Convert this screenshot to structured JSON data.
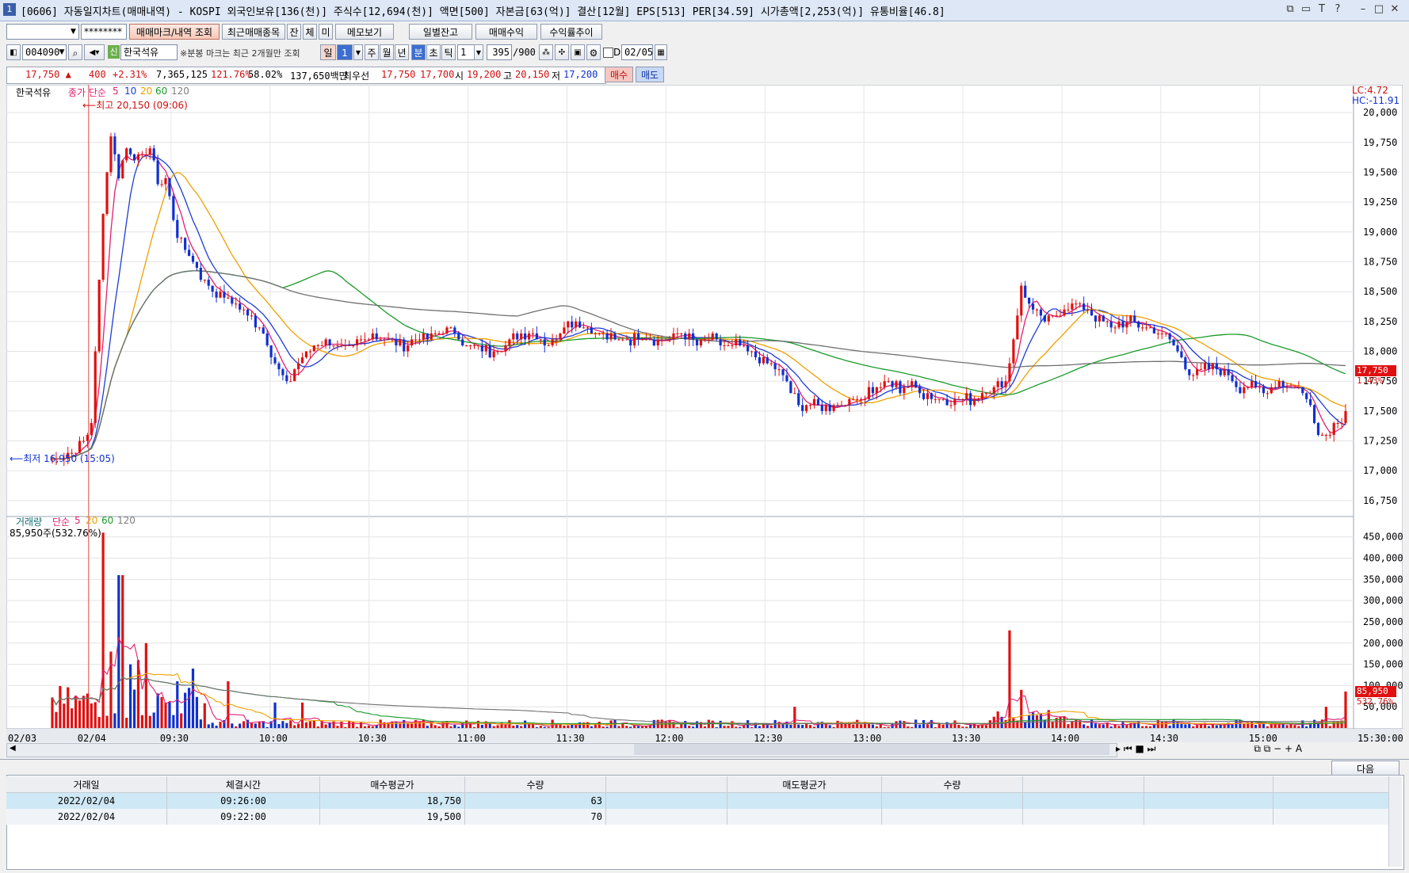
{
  "window": {
    "badge": "1",
    "title": "[0606] 자동일지차트(매매내역) - KOSPI 외국인보유[136(천)] 주식수[12,694(천)] 액면[500] 자본금[63(억)] 결산[12월] EPS[513] PER[34.59] 시가총액[2,253(억)] 유통비율[46.8]",
    "controls": [
      "⧉",
      "▭",
      "T",
      "?",
      "–",
      "□",
      "✕"
    ]
  },
  "toolbar1": {
    "account_value": "",
    "password_value": "********",
    "btn_trade_mark": "매매마크/내역 조회",
    "btn_recent": "최근매매종목",
    "btn_jan": "잔",
    "btn_che": "체",
    "btn_mi": "미",
    "btn_memo": "메모보기",
    "btn_daily_balance": "일별잔고",
    "btn_trade_profit": "매매수익",
    "btn_yield_trend": "수익률추이"
  },
  "toolbar2": {
    "code": "004090",
    "stock_name": "한국석유",
    "stock_badge": "신",
    "notice": "※분봉 마크는 최근 2개월만 조회",
    "period_il": "일",
    "period_value": "1",
    "period_ju": "주",
    "period_wol": "월",
    "period_nyeon": "년",
    "period_bun": "분",
    "period_cho": "초",
    "period_tik": "틱",
    "interval": "1",
    "count": "395",
    "count_total": "/900",
    "date_checkbox_label": "D",
    "date_value": "02/05"
  },
  "quote": {
    "price": "17,750",
    "change": "400",
    "change_pct": "+2.31%",
    "volume": "7,365,125",
    "volume_ratio": "121.76%",
    "turnover": "58.02%",
    "amount": "137,650백만",
    "best_label": "최우선",
    "ask": "17,750",
    "bid": "17,700",
    "open_label": "시",
    "open": "19,200",
    "high_label": "고",
    "high": "20,150",
    "low_label": "저",
    "low": "17,200",
    "buy_btn": "매수",
    "sell_btn": "매도"
  },
  "chart_data": [
    {
      "type": "candlestick",
      "title": "한국석유",
      "legend": {
        "price": "종가 단순",
        "ma": [
          "5",
          "10",
          "20",
          "60",
          "120"
        ]
      },
      "annotation_high": "최고 20,150 (09:06)",
      "annotation_low": "최저 16,950 (15:05)",
      "lc": "LC:4.72",
      "hc": "HC:-11.91",
      "last_label": "17,750",
      "last_pct": "1.43%",
      "yticks": [
        "20,000",
        "19,750",
        "19,500",
        "19,250",
        "19,000",
        "18,750",
        "18,500",
        "18,250",
        "18,000",
        "17,750",
        "17,500",
        "17,250",
        "17,000",
        "16,750"
      ],
      "ylim": [
        16650,
        20100
      ],
      "xticks": [
        "02/03",
        "02/04",
        "09:30",
        "10:00",
        "10:30",
        "11:00",
        "11:30",
        "12:00",
        "12:30",
        "13:00",
        "13:30",
        "14:00",
        "14:30",
        "15:00",
        "15:30:00"
      ],
      "close_path": [
        [
          0,
          17100
        ],
        [
          5,
          17150
        ],
        [
          8,
          17220
        ],
        [
          10,
          17400
        ],
        [
          12,
          18600
        ],
        [
          13,
          19200
        ],
        [
          15,
          19800
        ],
        [
          17,
          19500
        ],
        [
          19,
          19700
        ],
        [
          22,
          19600
        ],
        [
          25,
          19700
        ],
        [
          27,
          19400
        ],
        [
          29,
          19450
        ],
        [
          31,
          19100
        ],
        [
          33,
          18900
        ],
        [
          35,
          18800
        ],
        [
          37,
          18700
        ],
        [
          39,
          18600
        ],
        [
          41,
          18500
        ],
        [
          44,
          18450
        ],
        [
          47,
          18400
        ],
        [
          50,
          18300
        ],
        [
          53,
          18200
        ],
        [
          56,
          18000
        ],
        [
          58,
          17850
        ],
        [
          60,
          17700
        ],
        [
          62,
          17850
        ],
        [
          64,
          17950
        ],
        [
          67,
          18050
        ],
        [
          70,
          18100
        ],
        [
          73,
          18050
        ],
        [
          76,
          18000
        ],
        [
          79,
          18100
        ],
        [
          82,
          18150
        ],
        [
          85,
          18100
        ],
        [
          88,
          18050
        ],
        [
          91,
          18050
        ],
        [
          94,
          18150
        ],
        [
          97,
          18100
        ],
        [
          100,
          18200
        ],
        [
          103,
          18150
        ],
        [
          106,
          18050
        ],
        [
          109,
          18000
        ],
        [
          112,
          18000
        ],
        [
          115,
          18050
        ],
        [
          118,
          18100
        ],
        [
          121,
          18150
        ],
        [
          124,
          18150
        ],
        [
          127,
          18050
        ],
        [
          130,
          18200
        ],
        [
          133,
          18250
        ],
        [
          136,
          18200
        ],
        [
          139,
          18150
        ],
        [
          142,
          18100
        ],
        [
          145,
          18100
        ],
        [
          148,
          18100
        ],
        [
          151,
          18150
        ],
        [
          154,
          18100
        ],
        [
          157,
          18100
        ],
        [
          160,
          18150
        ],
        [
          163,
          18100
        ],
        [
          166,
          18050
        ],
        [
          169,
          18100
        ],
        [
          172,
          18050
        ],
        [
          175,
          18050
        ],
        [
          178,
          18000
        ],
        [
          181,
          17950
        ],
        [
          184,
          17900
        ],
        [
          187,
          17800
        ],
        [
          189,
          17650
        ],
        [
          191,
          17550
        ],
        [
          193,
          17550
        ],
        [
          196,
          17550
        ],
        [
          199,
          17550
        ],
        [
          202,
          17550
        ],
        [
          205,
          17600
        ],
        [
          208,
          17650
        ],
        [
          211,
          17700
        ],
        [
          214,
          17750
        ],
        [
          217,
          17700
        ],
        [
          220,
          17700
        ],
        [
          223,
          17650
        ],
        [
          226,
          17600
        ],
        [
          229,
          17600
        ],
        [
          232,
          17600
        ],
        [
          235,
          17600
        ],
        [
          238,
          17650
        ],
        [
          241,
          17700
        ],
        [
          244,
          17750
        ],
        [
          246,
          18100
        ],
        [
          248,
          18550
        ],
        [
          250,
          18400
        ],
        [
          253,
          18250
        ],
        [
          256,
          18300
        ],
        [
          259,
          18350
        ],
        [
          262,
          18400
        ],
        [
          265,
          18350
        ],
        [
          268,
          18250
        ],
        [
          271,
          18200
        ],
        [
          274,
          18250
        ],
        [
          277,
          18250
        ],
        [
          280,
          18200
        ],
        [
          283,
          18150
        ],
        [
          286,
          18100
        ],
        [
          289,
          17950
        ],
        [
          292,
          17800
        ],
        [
          295,
          17850
        ],
        [
          298,
          17850
        ],
        [
          301,
          17800
        ],
        [
          304,
          17700
        ],
        [
          307,
          17700
        ],
        [
          310,
          17650
        ],
        [
          313,
          17750
        ],
        [
          316,
          17700
        ],
        [
          319,
          17700
        ],
        [
          322,
          17550
        ],
        [
          324,
          17350
        ],
        [
          326,
          17300
        ],
        [
          328,
          17400
        ],
        [
          330,
          17450
        ],
        [
          331,
          17500
        ]
      ],
      "series": [
        {
          "name": "5",
          "color": "#e0206f"
        },
        {
          "name": "10",
          "color": "#1e3cd6"
        },
        {
          "name": "20",
          "color": "#f0a000"
        },
        {
          "name": "60",
          "color": "#1a9a2a"
        },
        {
          "name": "120",
          "color": "#707070"
        }
      ]
    },
    {
      "type": "bar",
      "title": "거래량",
      "legend": {
        "ma_label": "단순",
        "ma": [
          "5",
          "20",
          "60",
          "120"
        ]
      },
      "current": "85,950주(532.76%)",
      "last_label": "85,950",
      "last_pct": "532.76%",
      "yticks": [
        "450,000",
        "400,000",
        "350,000",
        "300,000",
        "250,000",
        "200,000",
        "150,000",
        "100,000",
        "50,000"
      ],
      "ylim": [
        0,
        470000
      ],
      "spikes": [
        [
          13,
          460000
        ],
        [
          15,
          180000
        ],
        [
          17,
          360000
        ],
        [
          18,
          360000
        ],
        [
          20,
          150000
        ],
        [
          22,
          160000
        ],
        [
          24,
          200000
        ],
        [
          32,
          110000
        ],
        [
          36,
          140000
        ],
        [
          45,
          110000
        ],
        [
          57,
          60000
        ],
        [
          64,
          60000
        ],
        [
          190,
          50000
        ],
        [
          245,
          230000
        ],
        [
          248,
          90000
        ],
        [
          326,
          50000
        ],
        [
          331,
          85950
        ]
      ]
    }
  ],
  "hscroll": {
    "right_controls": [
      "▸",
      "⏮",
      "■",
      "⏭",
      "⧉",
      "⧉",
      "−",
      "+",
      "A"
    ]
  },
  "bottom": {
    "next_btn": "다음",
    "columns": [
      "거래일",
      "체결시간",
      "매수평균가",
      "수량",
      "",
      "매도평균가",
      "수량",
      "",
      "",
      ""
    ],
    "rows": [
      [
        "2022/02/04",
        "09:26:00",
        "18,750",
        "63",
        "",
        "",
        "",
        "",
        "",
        ""
      ],
      [
        "2022/02/04",
        "09:22:00",
        "19,500",
        "70",
        "",
        "",
        "",
        "",
        "",
        ""
      ]
    ]
  }
}
